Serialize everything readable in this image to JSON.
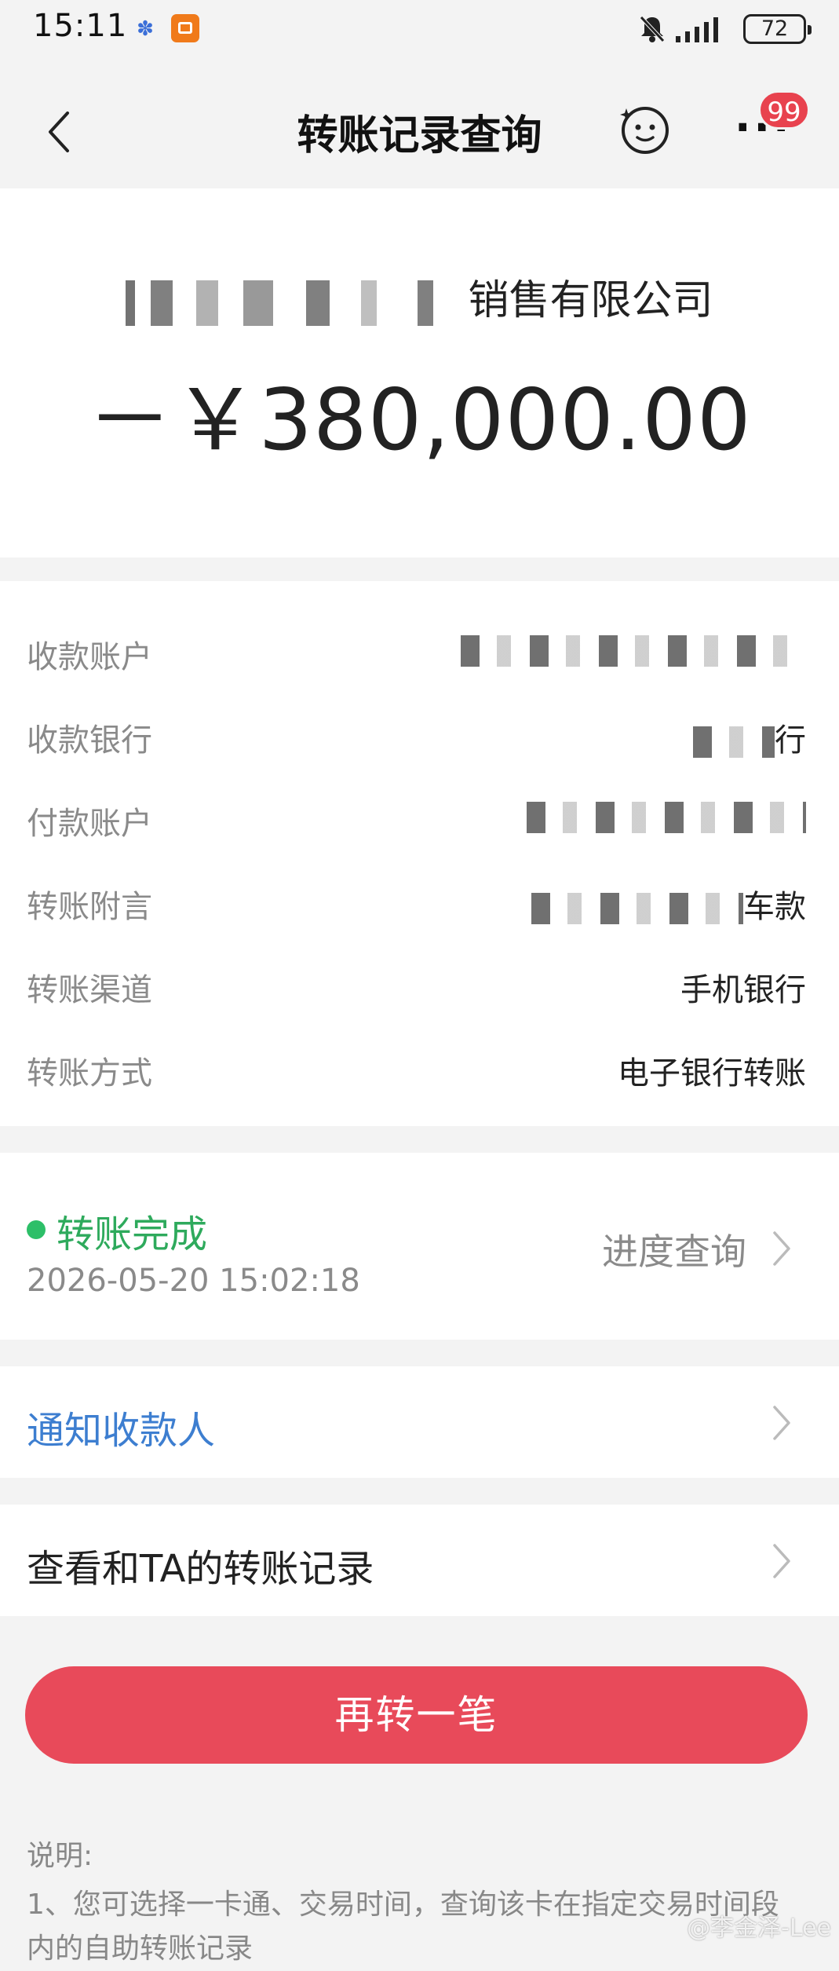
{
  "status_bar": {
    "time": "15:11",
    "battery": "72",
    "icons": [
      "baidu-icon",
      "app-icon",
      "bell-off-icon",
      "signal-icon",
      "battery-icon"
    ]
  },
  "nav": {
    "title": "转账记录查询",
    "badge": "99",
    "icons": [
      "back-icon",
      "service-icon",
      "more-icon"
    ]
  },
  "header": {
    "company_suffix": "销售有限公司",
    "amount": "－￥380,000.00"
  },
  "details": [
    {
      "label": "收款账户",
      "value": ""
    },
    {
      "label": "收款银行",
      "value": "行"
    },
    {
      "label": "付款账户",
      "value": ""
    },
    {
      "label": "转账附言",
      "value": "车款"
    },
    {
      "label": "转账渠道",
      "value": "手机银行"
    },
    {
      "label": "转账方式",
      "value": "电子银行转账"
    }
  ],
  "status": {
    "text": "转账完成",
    "datetime": "2026-05-20 15:02:18",
    "progress_link": "进度查询",
    "color": "#2eaa5c"
  },
  "actions": {
    "notify_payee": "通知收款人",
    "view_history": "查看和TA的转账记录",
    "transfer_again": "再转一笔"
  },
  "notes": {
    "title": "说明:",
    "line1": "1、您可选择一卡通、交易时间，查询该卡在指定交易时间段内的自助转账记录"
  },
  "watermark": "@李金泽-Lee",
  "colors": {
    "primary_button": "#e84a5a",
    "link": "#3d7ed0",
    "badge": "#e8424e"
  }
}
